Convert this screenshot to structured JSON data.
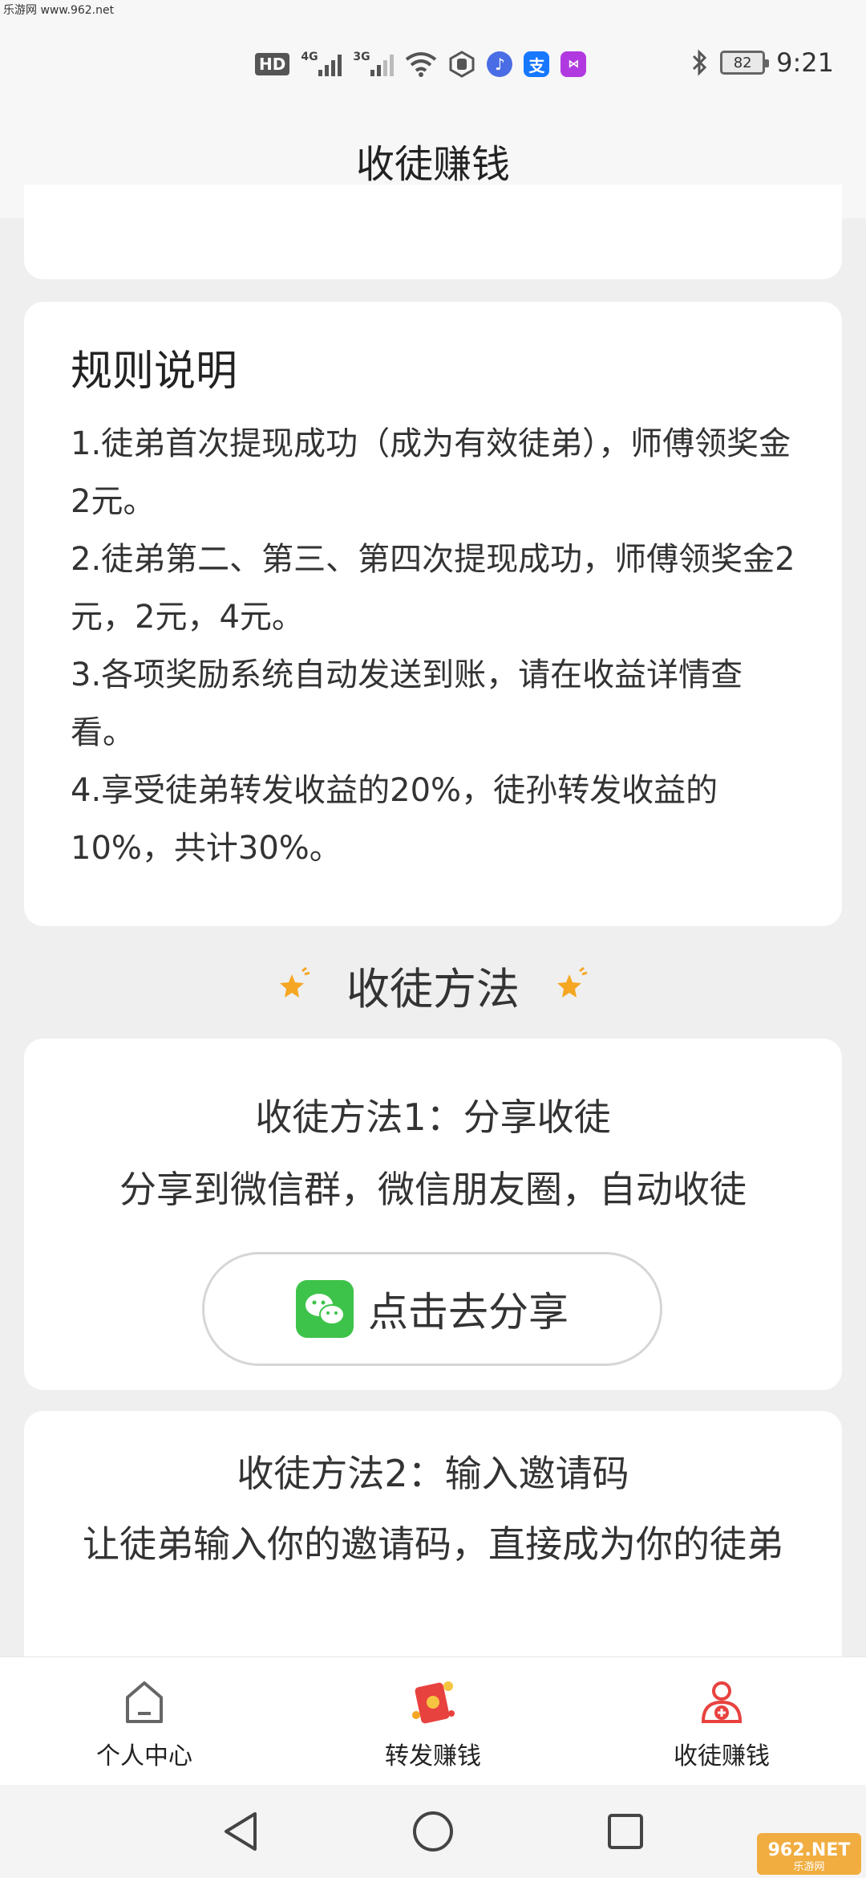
{
  "watermark": "乐游网 www.962.net",
  "status_bar": {
    "hd": "HD",
    "net1": "4G",
    "net2": "3G",
    "alipay_glyph": "支",
    "battery": "82",
    "time": "9:21",
    "icons": [
      "hd-icon",
      "signal-4g-icon",
      "signal-3g-icon",
      "wifi-icon",
      "hexagon-app-icon",
      "music-app-icon",
      "alipay-icon",
      "gylm-app-icon",
      "bluetooth-icon",
      "battery-icon"
    ]
  },
  "header": {
    "title": "收徒赚钱"
  },
  "rules": {
    "title": "规则说明",
    "items": [
      "1.徒弟首次提现成功（成为有效徒弟），师傅领奖金2元。",
      "2.徒弟第二、第三、第四次提现成功，师傅领奖金2元，2元，4元。",
      "3.各项奖励系统自动发送到账，请在收益详情查看。",
      "4.享受徒弟转发收益的20%，徒孙转发收益的10%，共计30%。"
    ]
  },
  "methods_heading": "收徒方法",
  "method1": {
    "title": "收徒方法1：分享收徒",
    "desc": "分享到微信群，微信朋友圈，自动收徒",
    "button": "点击去分享"
  },
  "method2": {
    "title": "收徒方法2：输入邀请码",
    "desc": "让徒弟输入你的邀请码，直接成为你的徒弟"
  },
  "tabs": [
    {
      "label": "个人中心",
      "icon": "home-icon"
    },
    {
      "label": "转发赚钱",
      "icon": "red-envelope-icon"
    },
    {
      "label": "收徒赚钱",
      "icon": "user-add-icon"
    }
  ],
  "colors": {
    "accent_red": "#e8423f",
    "wechat_green": "#3ec34a",
    "star_orange": "#f5a623"
  },
  "corner_logo": "962.NET 乐游网"
}
